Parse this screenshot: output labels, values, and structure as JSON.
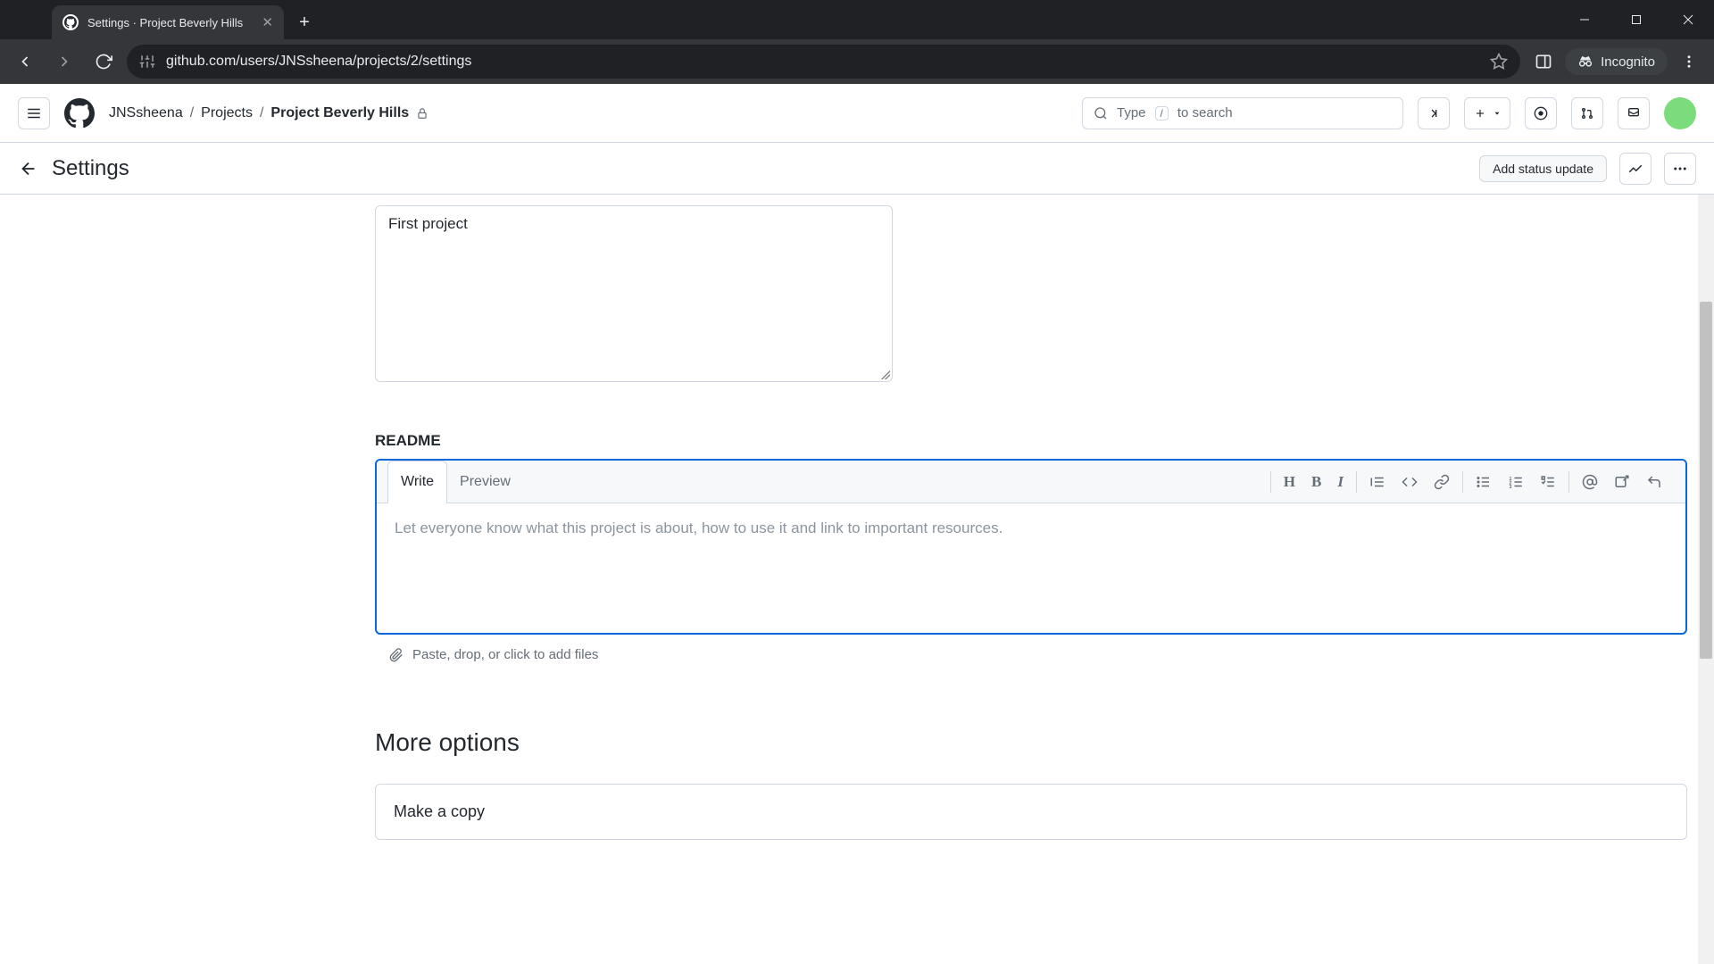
{
  "browser": {
    "tab_title": "Settings · Project Beverly Hills",
    "url_display": "github.com/users/JNSsheena/projects/2/settings",
    "incognito_label": "Incognito"
  },
  "github_header": {
    "breadcrumb": {
      "owner": "JNSsheena",
      "section": "Projects",
      "project": "Project Beverly Hills"
    },
    "search_hint_pre": "Type",
    "search_hint_key": "/",
    "search_hint_post": "to search"
  },
  "settings_bar": {
    "title": "Settings",
    "add_status_label": "Add status update"
  },
  "main": {
    "description_value": "First project",
    "readme_label": "README",
    "tabs": {
      "write": "Write",
      "preview": "Preview"
    },
    "readme_placeholder": "Let everyone know what this project is about, how to use it and link to important resources.",
    "attach_hint": "Paste, drop, or click to add files",
    "more_options_heading": "More options",
    "make_copy": "Make a copy"
  },
  "toolbar": {
    "heading": "H",
    "bold": "B",
    "italic": "I"
  }
}
